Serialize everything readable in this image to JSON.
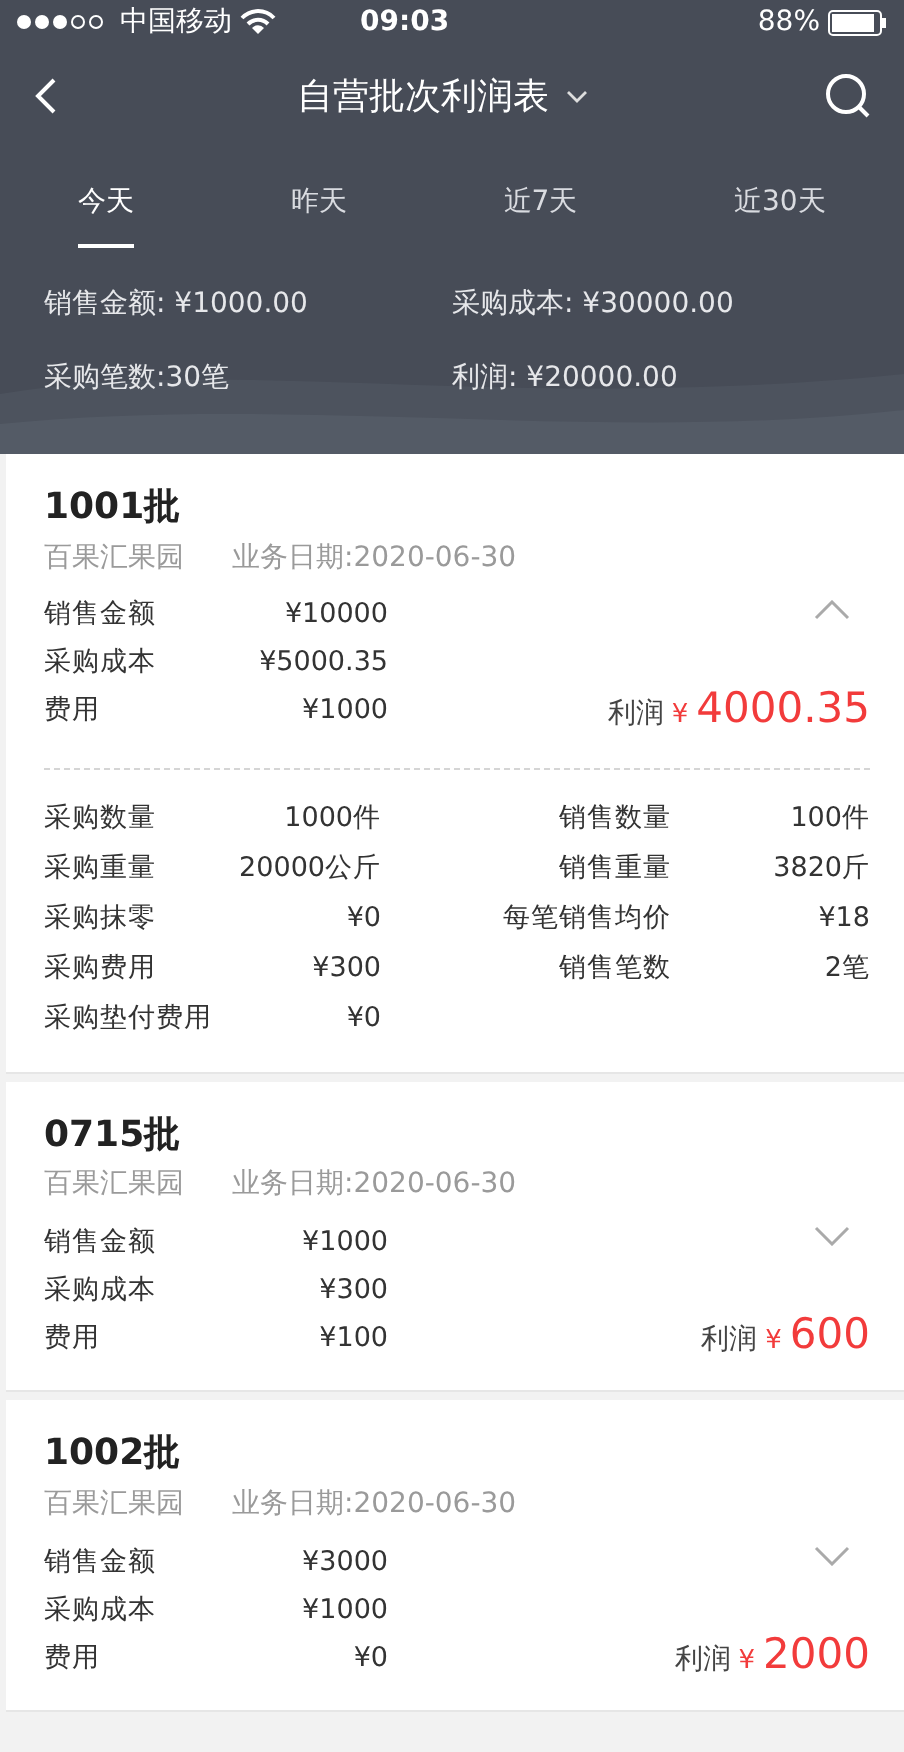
{
  "status_bar": {
    "carrier": "中国移动",
    "time": "09:03",
    "battery": "88%"
  },
  "header": {
    "title": "自营批次利润表"
  },
  "tabs": [
    {
      "label": "今天",
      "selected": true
    },
    {
      "label": "昨天",
      "selected": false
    },
    {
      "label": "近7天",
      "selected": false
    },
    {
      "label": "近30天",
      "selected": false
    }
  ],
  "summary": [
    "销售金额: ¥1000.00",
    "采购成本: ¥30000.00",
    "采购笔数:30笔",
    "利润: ¥20000.00"
  ],
  "batches": [
    {
      "title": "1001批",
      "farm": "百果汇果园",
      "date": "业务日期:2020-06-30",
      "expanded": true,
      "rows": [
        {
          "label": "销售金额",
          "value": "¥10000"
        },
        {
          "label": "采购成本",
          "value": "¥5000.35"
        },
        {
          "label": "费用",
          "value": "¥1000"
        }
      ],
      "profit_label": "利润",
      "currency": "¥",
      "profit": "4000.35",
      "details": [
        {
          "label": "采购数量",
          "value": "1000件"
        },
        {
          "label": "销售数量",
          "value": "100件"
        },
        {
          "label": "采购重量",
          "value": "20000公斤"
        },
        {
          "label": "销售重量",
          "value": "3820斤"
        },
        {
          "label": "采购抹零",
          "value": "¥0"
        },
        {
          "label": "每笔销售均价",
          "value": "¥18"
        },
        {
          "label": "采购费用",
          "value": "¥300"
        },
        {
          "label": "销售笔数",
          "value": "2笔"
        },
        {
          "label": "采购垫付费用",
          "value": "¥0"
        }
      ]
    },
    {
      "title": "0715批",
      "farm": "百果汇果园",
      "date": "业务日期:2020-06-30",
      "expanded": false,
      "rows": [
        {
          "label": "销售金额",
          "value": "¥1000"
        },
        {
          "label": "采购成本",
          "value": "¥300"
        },
        {
          "label": "费用",
          "value": "¥100"
        }
      ],
      "profit_label": "利润",
      "currency": "¥",
      "profit": "600"
    },
    {
      "title": "1002批",
      "farm": "百果汇果园",
      "date": "业务日期:2020-06-30",
      "expanded": false,
      "rows": [
        {
          "label": "销售金额",
          "value": "¥3000"
        },
        {
          "label": "采购成本",
          "value": "¥1000"
        },
        {
          "label": "费用",
          "value": "¥0"
        }
      ],
      "profit_label": "利润",
      "currency": "¥",
      "profit": "2000"
    }
  ]
}
